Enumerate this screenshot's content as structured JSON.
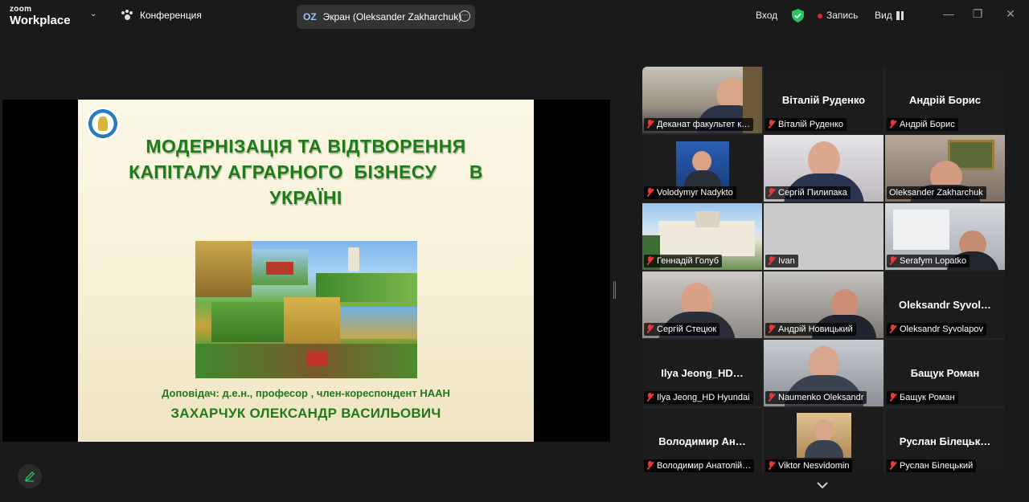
{
  "app": {
    "logo_top": "zoom",
    "logo_bottom": "Workplace"
  },
  "meeting": {
    "title": "Конференция"
  },
  "share_pill": {
    "initials": "OZ",
    "label": "Экран (Oleksander Zakharchuk)"
  },
  "toolbar": {
    "signin": "Вход",
    "record": "Запись",
    "view": "Вид"
  },
  "colors": {
    "accent_green": "#25c45e",
    "slide_green": "#1f7a1a",
    "mic_red": "#e23b3b"
  },
  "slide": {
    "title_lines": [
      "МОДЕРНІЗАЦІЯ ТА ВІДТВОРЕННЯ",
      "КАПІТАЛУ АГРАРНОГО  БІЗНЕСУ      В",
      "УКРАЇНІ"
    ],
    "presenter": "Доповідач:   д.е.н., професор , член-кореспондент НААН",
    "name": "ЗАХАРЧУК ОЛЕКСАНДР ВАСИЛЬОВИЧ"
  },
  "participants": [
    {
      "name": "Деканат факультет к…",
      "center": ""
    },
    {
      "name": "Віталій Руденко",
      "center": "Віталій Руденко"
    },
    {
      "name": "Андрій Борис",
      "center": "Андрій Борис"
    },
    {
      "name": "Volodymyr Nadykto",
      "center": ""
    },
    {
      "name": "Сергій Пилипака",
      "center": ""
    },
    {
      "name": "Oleksander Zakharchuk",
      "center": ""
    },
    {
      "name": "Геннадій Голуб",
      "center": ""
    },
    {
      "name": "Ivan",
      "center": ""
    },
    {
      "name": "Serafym Lopatko",
      "center": ""
    },
    {
      "name": "Сергій Стецюк",
      "center": ""
    },
    {
      "name": "Андрій Новицький",
      "center": ""
    },
    {
      "name": "Oleksandr Syvolapov",
      "center": "Oleksandr  Syvol…"
    },
    {
      "name": "Ilya Jeong_HD Hyundai",
      "center": "Ilya  Jeong_HD…"
    },
    {
      "name": "Naumenko Oleksandr",
      "center": ""
    },
    {
      "name": "Бащук Роман",
      "center": "Бащук Роман"
    },
    {
      "name": "Володимир Анатолій…",
      "center": "Володимир  Ан…"
    },
    {
      "name": "Viktor Nesvidomin",
      "center": ""
    },
    {
      "name": "Руслан Білецький",
      "center": "Руслан  Білецьк…"
    }
  ]
}
